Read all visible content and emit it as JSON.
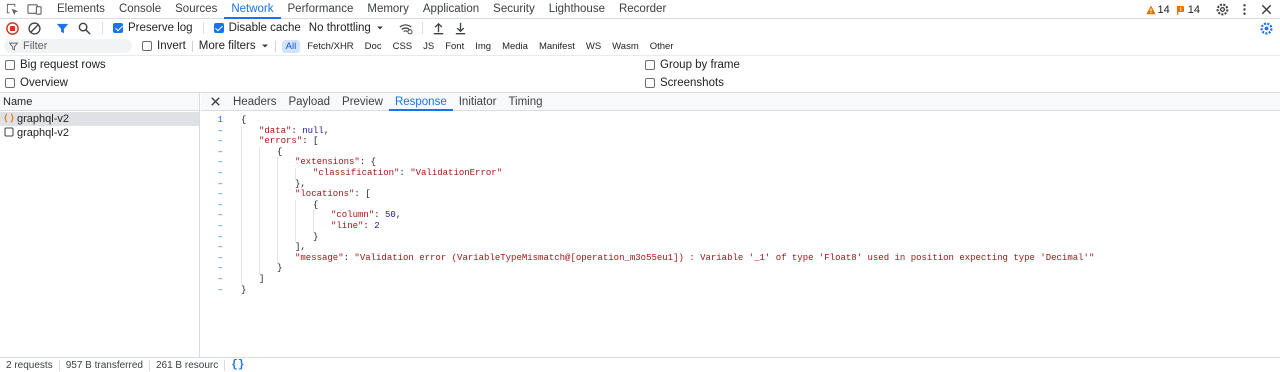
{
  "top_tabs": [
    "Elements",
    "Console",
    "Sources",
    "Network",
    "Performance",
    "Memory",
    "Application",
    "Security",
    "Lighthouse",
    "Recorder"
  ],
  "active_tab": "Network",
  "badges": {
    "warnings": "14",
    "issues": "14"
  },
  "toolbar": {
    "preserve_log": "Preserve log",
    "disable_cache": "Disable cache",
    "throttling": "No throttling"
  },
  "filter": {
    "placeholder": "Filter",
    "invert": "Invert",
    "more_filters": "More filters",
    "chips": [
      "All",
      "Fetch/XHR",
      "Doc",
      "CSS",
      "JS",
      "Font",
      "Img",
      "Media",
      "Manifest",
      "WS",
      "Wasm",
      "Other"
    ]
  },
  "options": {
    "big_request_rows": "Big request rows",
    "overview": "Overview",
    "group_by_frame": "Group by frame",
    "screenshots": "Screenshots"
  },
  "requests": {
    "header": "Name",
    "items": [
      "graphql-v2",
      "graphql-v2"
    ]
  },
  "detail_tabs": [
    "Headers",
    "Payload",
    "Preview",
    "Response",
    "Initiator",
    "Timing"
  ],
  "active_detail_tab": "Response",
  "response_lines": [
    {
      "ln": "1",
      "indent": 0,
      "text": "{"
    },
    {
      "ln": "–",
      "indent": 1,
      "key": "\"data\"",
      "rest": ": ",
      "val": "null",
      "vclass": "kw",
      "tail": ","
    },
    {
      "ln": "–",
      "indent": 1,
      "key": "\"errors\"",
      "rest": ": [",
      "val": "",
      "vclass": "",
      "tail": ""
    },
    {
      "ln": "–",
      "indent": 2,
      "text": "{"
    },
    {
      "ln": "–",
      "indent": 3,
      "key": "\"extensions\"",
      "rest": ": {",
      "val": "",
      "vclass": "",
      "tail": ""
    },
    {
      "ln": "–",
      "indent": 4,
      "key": "\"classification\"",
      "rest": ": ",
      "val": "\"ValidationError\"",
      "vclass": "s",
      "tail": ""
    },
    {
      "ln": "–",
      "indent": 3,
      "text": "},"
    },
    {
      "ln": "–",
      "indent": 3,
      "key": "\"locations\"",
      "rest": ": [",
      "val": "",
      "vclass": "",
      "tail": ""
    },
    {
      "ln": "–",
      "indent": 4,
      "text": "{"
    },
    {
      "ln": "–",
      "indent": 5,
      "key": "\"column\"",
      "rest": ": ",
      "val": "50",
      "vclass": "n",
      "tail": ","
    },
    {
      "ln": "–",
      "indent": 5,
      "key": "\"line\"",
      "rest": ": ",
      "val": "2",
      "vclass": "n",
      "tail": ""
    },
    {
      "ln": "–",
      "indent": 4,
      "text": "}"
    },
    {
      "ln": "–",
      "indent": 3,
      "text": "],"
    },
    {
      "ln": "–",
      "indent": 3,
      "key": "\"message\"",
      "rest": ": ",
      "val": "\"Validation error (VariableTypeMismatch@[operation_m3o55eu1]) : Variable '_1' of type 'Float8' used in position expecting type 'Decimal'\"",
      "vclass": "s",
      "tail": ""
    },
    {
      "ln": "–",
      "indent": 2,
      "text": "}"
    },
    {
      "ln": "–",
      "indent": 1,
      "text": "]"
    },
    {
      "ln": "–",
      "indent": 0,
      "text": "}"
    }
  ],
  "status": {
    "requests": "2 requests",
    "transferred": "957 B transferred",
    "resources": "261 B resourc",
    "pretty_print": "{}"
  },
  "colors": {
    "accent": "#1a73e8",
    "record": "#d93025",
    "warning": "#e37400"
  }
}
